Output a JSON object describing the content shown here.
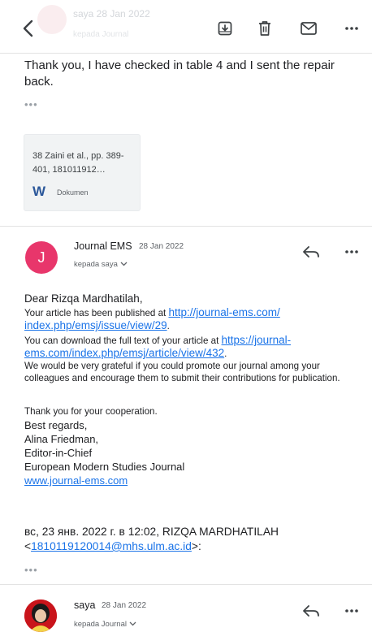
{
  "toolbar": {
    "back_icon": "chevron-left-icon",
    "actions": [
      "archive-icon",
      "trash-icon",
      "mail-icon",
      "more-icon"
    ],
    "faded_sender": "saya  28 Jan 2022",
    "faded_to": "kepada Journal"
  },
  "previous_message": {
    "text": "Thank you, I have checked in table 4 and I sent the repair back.",
    "ellipsis": "•••",
    "attachment": {
      "name": "38 Zaini et al., pp. 389-401, 181011912…",
      "type_label": "Dokumen",
      "icon": "W"
    }
  },
  "message": {
    "avatar_letter": "J",
    "avatar_color": "#e8366b",
    "sender": "Journal EMS",
    "date": "28 Jan 2022",
    "recipient": "kepada saya",
    "greeting": "Dear Rizqa Mardhatilah,",
    "line1_prefix": "Your article has been published at ",
    "line1_link_a": "http://journal-ems.com/",
    "line1_link_b": "index.php/emsj/issue/view/29",
    "line1_suffix": ".",
    "line2_prefix": "You can download the full text of your article at ",
    "line2_link_a": "https://journal-",
    "line2_link_b": "ems.com/index.php/emsj/article/view/432",
    "line2_suffix": ".",
    "line3": "We would be very grateful if you could promote our journal among your colleagues and encourage them to submit their contributions for publication.",
    "thanks": "Thank you for your cooperation.",
    "sign1": "Best regards,",
    "sign2": "Alina Friedman,",
    "sign3": "Editor-in-Chief",
    "sign4": "European Modern Studies Journal",
    "website": "www.journal-ems.com",
    "quote_header_a": "вс, 23 янв. 2022 г. в 12:02, RIZQA MARDHATILAH",
    "quote_header_lt": "<",
    "quote_email": "1810119120014@mhs.ulm.ac.id",
    "quote_header_gt": ">:",
    "ellipsis": "•••"
  },
  "next_message": {
    "sender": "saya",
    "date": "28 Jan 2022",
    "recipient": "kepada Journal"
  },
  "colors": {
    "link": "#1a73e8",
    "divider": "#e3e3e3",
    "icon": "#3c4043"
  }
}
